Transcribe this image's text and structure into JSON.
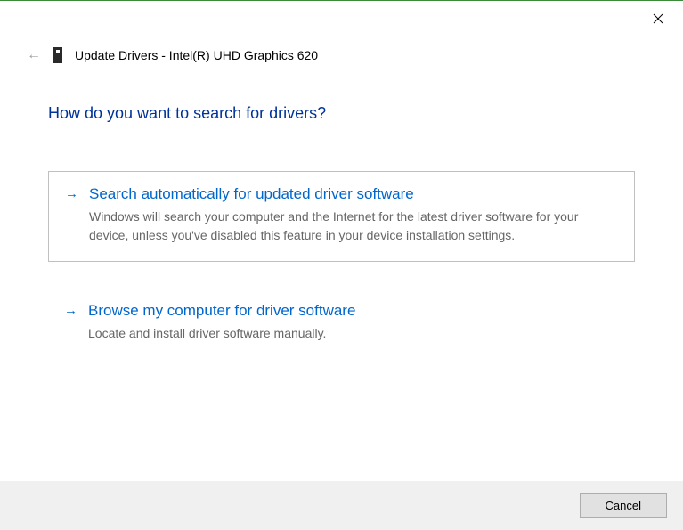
{
  "header": {
    "title": "Update Drivers - Intel(R) UHD Graphics 620"
  },
  "heading": "How do you want to search for drivers?",
  "options": [
    {
      "title": "Search automatically for updated driver software",
      "description": "Windows will search your computer and the Internet for the latest driver software for your device, unless you've disabled this feature in your device installation settings."
    },
    {
      "title": "Browse my computer for driver software",
      "description": "Locate and install driver software manually."
    }
  ],
  "footer": {
    "cancel_label": "Cancel"
  }
}
